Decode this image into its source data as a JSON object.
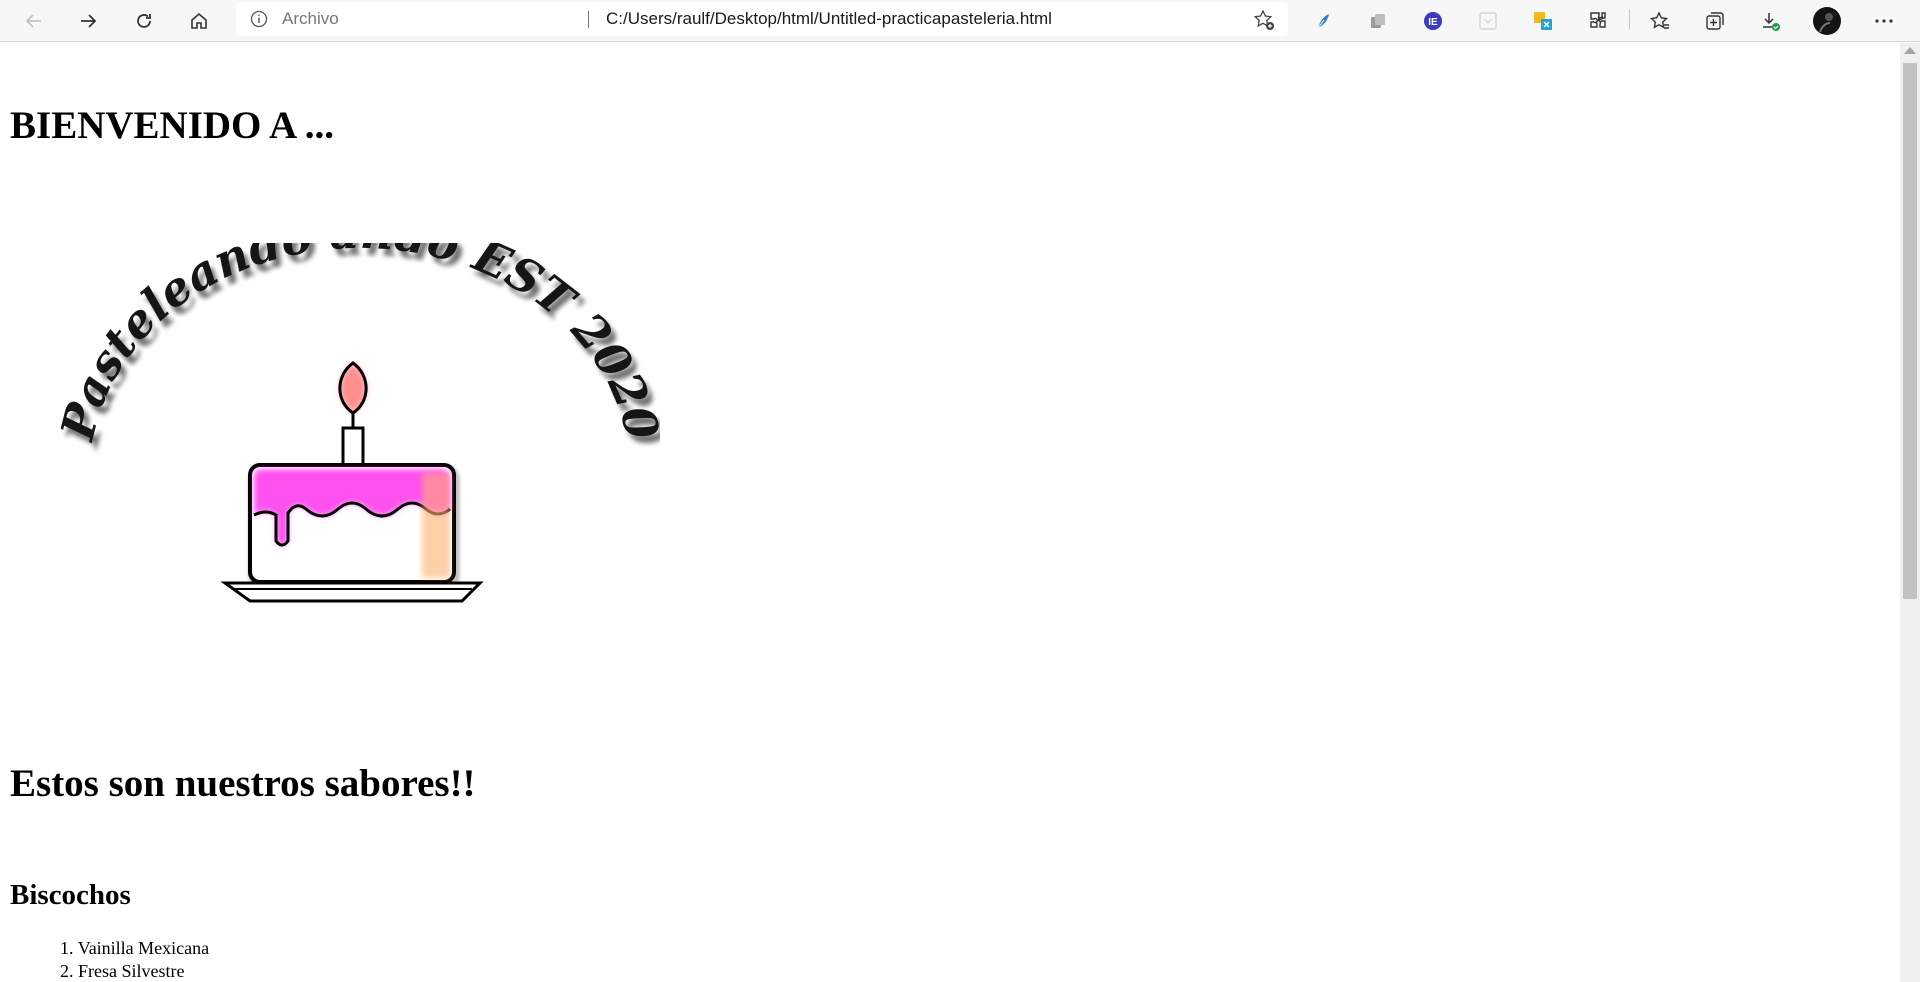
{
  "browser": {
    "site_label": "Archivo",
    "url": "C:/Users/raulf/Desktop/html/Untitled-practicapasteleria.html",
    "icons": [
      "back-icon",
      "forward-icon",
      "refresh-icon",
      "home-icon",
      "info-icon",
      "add-favorite-icon",
      "feather-extension-icon",
      "copy-extension-icon",
      "ie-mode-icon",
      "pocket-extension-icon",
      "translate-extension-icon",
      "extensions-icon",
      "favorites-icon",
      "collections-icon",
      "downloads-icon",
      "profile-avatar",
      "more-icon"
    ],
    "accent_color": "#1a73e8"
  },
  "page": {
    "heading": "BIENVENIDO A ...",
    "logo": {
      "text": "Pasteleando ando EST 2020",
      "frosting_color": "#ff33ee",
      "flame_color": "#ff6b6b"
    },
    "flavors_heading": "Estos son nuestros sabores!!",
    "section_title": "Biscochos",
    "items": [
      {
        "number": "1.",
        "label": "Vainilla Mexicana"
      },
      {
        "number": "2.",
        "label": "Fresa Silvestre"
      }
    ]
  }
}
